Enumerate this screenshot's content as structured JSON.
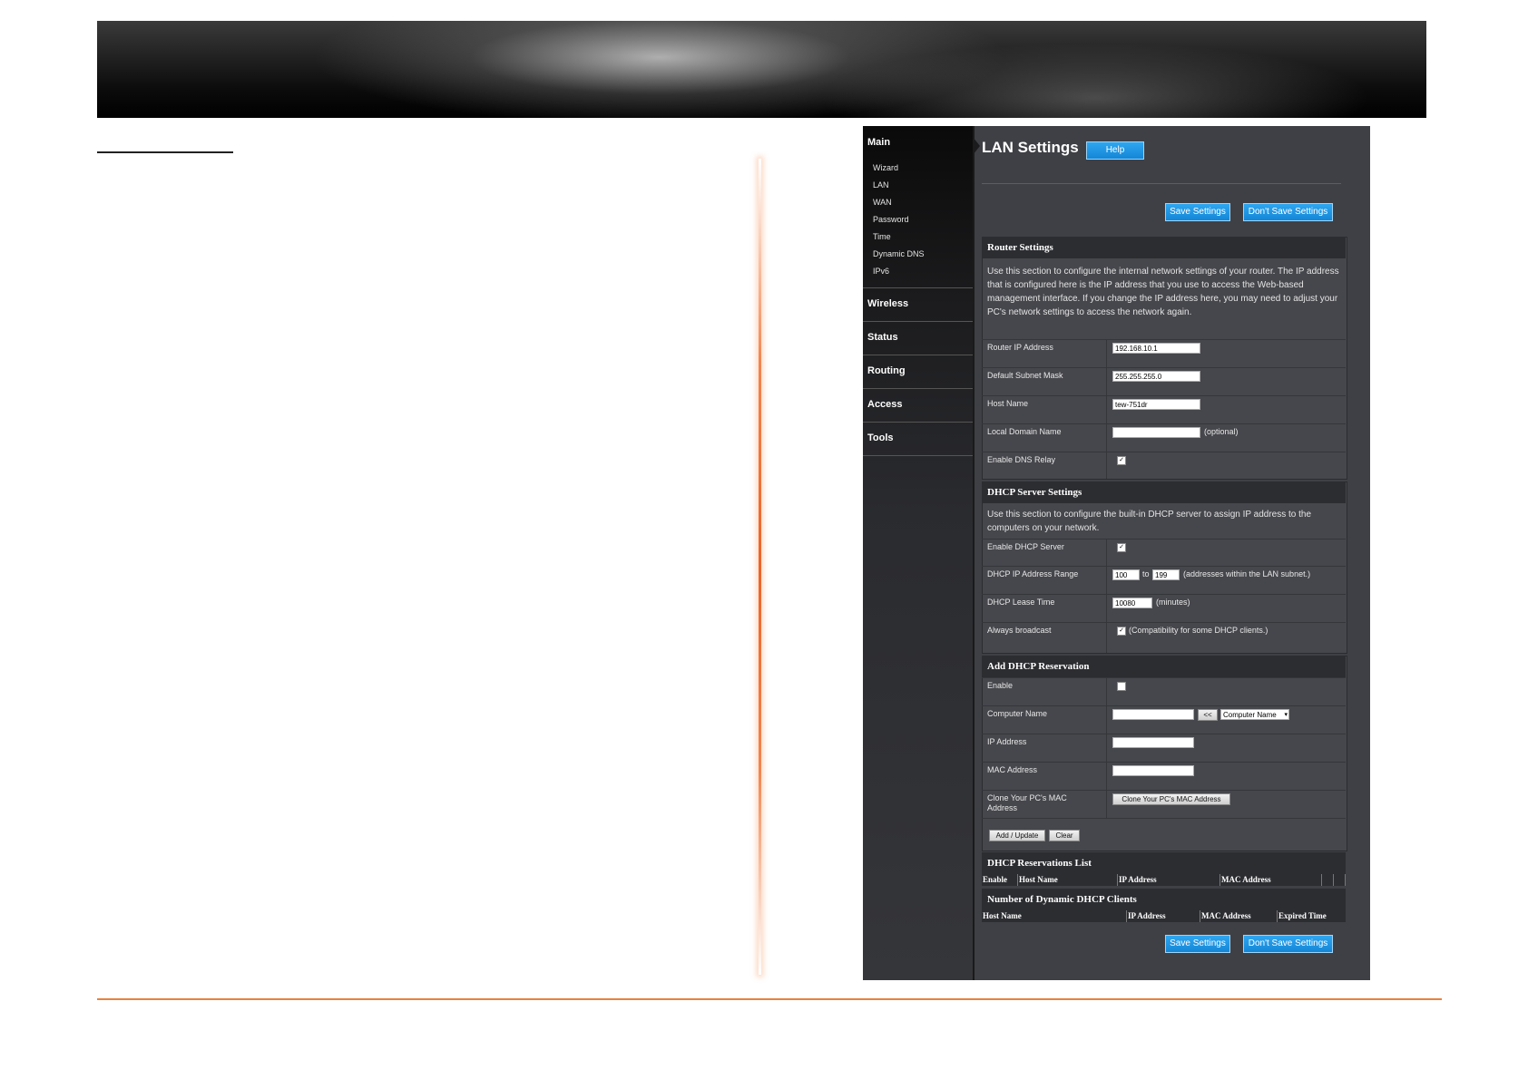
{
  "nav": {
    "main": "Main",
    "main_items": [
      "Wizard",
      "LAN",
      "WAN",
      "Password",
      "Time",
      "Dynamic DNS",
      "IPv6"
    ],
    "sections": [
      "Wireless",
      "Status",
      "Routing",
      "Access",
      "Tools"
    ]
  },
  "page": {
    "title": "LAN Settings",
    "help_label": "Help",
    "save_label": "Save Settings",
    "dont_save_label": "Don't Save Settings"
  },
  "router_settings": {
    "header": "Router Settings",
    "description": "Use this section to configure the internal network settings of your router. The IP address that is configured here is the IP address that you use to access the Web-based management interface. If you change the IP address here, you may need to adjust your PC's network settings to access the network again.",
    "router_ip_label": "Router IP Address",
    "router_ip_value": "192.168.10.1",
    "subnet_label": "Default Subnet Mask",
    "subnet_value": "255.255.255.0",
    "host_label": "Host Name",
    "host_value": "tew-751dr",
    "domain_label": "Local Domain Name",
    "domain_value": "",
    "domain_hint": "(optional)",
    "dns_relay_label": "Enable DNS Relay",
    "dns_relay_checked": true
  },
  "dhcp_server": {
    "header": "DHCP Server Settings",
    "description": "Use this section to configure the built-in DHCP server to assign IP address to the computers on your network.",
    "enable_label": "Enable DHCP Server",
    "enable_checked": true,
    "range_label": "DHCP IP Address Range",
    "range_start": "100",
    "range_to": "to",
    "range_end": "199",
    "range_hint": "(addresses within the LAN subnet.)",
    "lease_label": "DHCP Lease Time",
    "lease_value": "10080",
    "lease_hint": "(minutes)",
    "broadcast_label": "Always broadcast",
    "broadcast_checked": true,
    "broadcast_hint": "(Compatibility for some DHCP clients.)"
  },
  "reservation": {
    "header": "Add DHCP Reservation",
    "enable_label": "Enable",
    "enable_checked": false,
    "computer_label": "Computer Name",
    "computer_value": "",
    "arrow_label": "<<",
    "computer_select": "Computer Name",
    "ip_label": "IP Address",
    "mac_label": "MAC Address",
    "clone_label": "Clone Your PC's MAC Address",
    "clone_button": "Clone Your PC's MAC Address",
    "add_button": "Add / Update",
    "clear_button": "Clear"
  },
  "reservations_list": {
    "header": "DHCP Reservations List",
    "columns": [
      "Enable",
      "Host Name",
      "IP Address",
      "MAC Address"
    ]
  },
  "dynamic_clients": {
    "header": "Number of Dynamic DHCP Clients",
    "columns": [
      "Host Name",
      "IP Address",
      "MAC Address",
      "Expired Time"
    ]
  }
}
